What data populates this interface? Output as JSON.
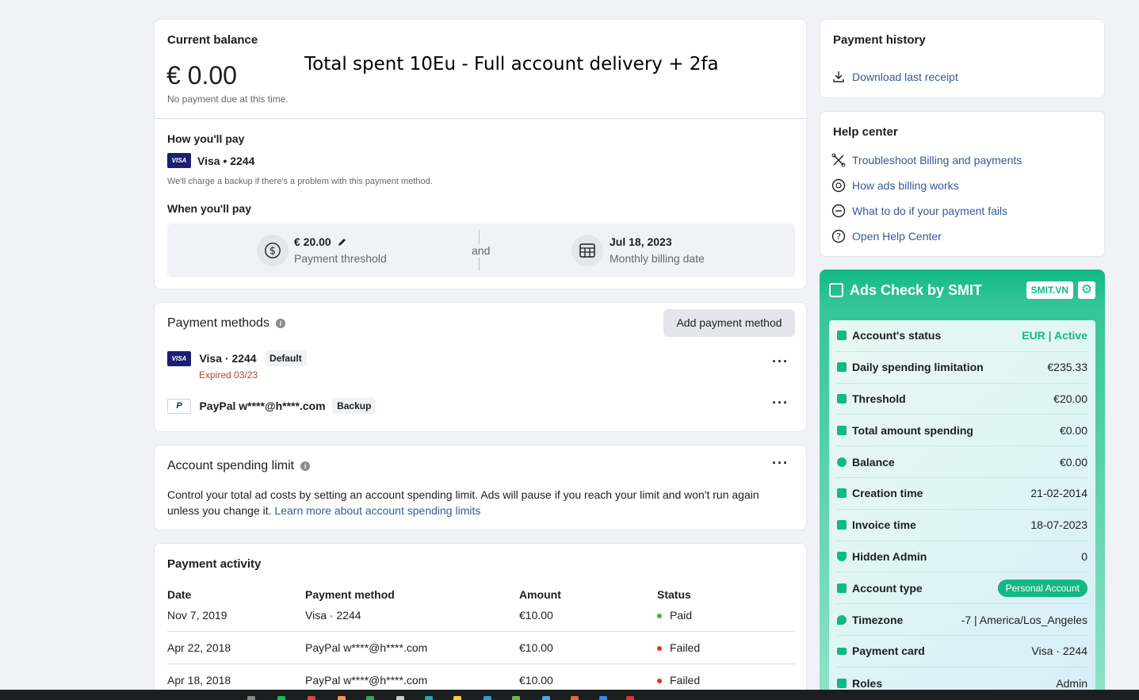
{
  "balance": {
    "title": "Current balance",
    "amount": "€ 0.00",
    "note": "No payment due at this time.",
    "overlay": "Total spent 10Eu - Full account delivery + 2fa",
    "how_title": "How you'll pay",
    "card": "Visa • 2244",
    "visa_logo": "VISA",
    "backup_note": "We'll charge a backup if there's a problem with this payment method.",
    "when_title": "When you'll pay",
    "threshold_value": "€ 20.00",
    "threshold_label": "Payment threshold",
    "and": "and",
    "date_value": "Jul 18, 2023",
    "date_label": "Monthly billing date"
  },
  "methods": {
    "title": "Payment methods",
    "add_label": "Add payment method",
    "items": [
      {
        "name": "Visa · 2244",
        "badge": "Default",
        "sub": "Expired 03/23"
      },
      {
        "name": "PayPal w****@h****.com",
        "badge": "Backup",
        "sub": ""
      }
    ]
  },
  "limit": {
    "title": "Account spending limit",
    "text": "Control your total ad costs by setting an account spending limit. Ads will pause if you reach your limit and won't run again unless you change it.",
    "link": "Learn more about account spending limits"
  },
  "activity": {
    "title": "Payment activity",
    "headers": [
      "Date",
      "Payment method",
      "Amount",
      "Status"
    ],
    "rows": [
      {
        "date": "Nov 7, 2019",
        "method": "Visa · 2244",
        "amount": "€10.00",
        "status": "Paid"
      },
      {
        "date": "Apr 22, 2018",
        "method": "PayPal w****@h****.com",
        "amount": "€10.00",
        "status": "Failed"
      },
      {
        "date": "Apr 18, 2018",
        "method": "PayPal w****@h****.com",
        "amount": "€10.00",
        "status": "Failed"
      }
    ]
  },
  "history": {
    "title": "Payment history",
    "download": "Download last receipt"
  },
  "help": {
    "title": "Help center",
    "links": [
      "Troubleshoot Billing and payments",
      "How ads billing works",
      "What to do if your payment fails",
      "Open Help Center"
    ]
  },
  "smit": {
    "title": "Ads Check by SMIT",
    "badge": "SMIT.VN",
    "rows": [
      {
        "label": "Account's status",
        "value": "EUR | Active"
      },
      {
        "label": "Daily spending limitation",
        "value": "€235.33"
      },
      {
        "label": "Threshold",
        "value": "€20.00"
      },
      {
        "label": "Total amount spending",
        "value": "€0.00"
      },
      {
        "label": "Balance",
        "value": "€0.00"
      },
      {
        "label": "Creation time",
        "value": "21-02-2014"
      },
      {
        "label": "Invoice time",
        "value": "18-07-2023"
      },
      {
        "label": "Hidden Admin",
        "value": "0"
      },
      {
        "label": "Account type",
        "value": "Personal Account"
      },
      {
        "label": "Timezone",
        "value": "-7 | America/Los_Angeles"
      },
      {
        "label": "Payment card",
        "value": "Visa · 2244"
      },
      {
        "label": "Roles",
        "value": "Admin"
      }
    ]
  },
  "colors": {
    "link": "#385898",
    "smit_green": "#12b886",
    "paid": "#42b72a",
    "failed": "#e4360a"
  }
}
